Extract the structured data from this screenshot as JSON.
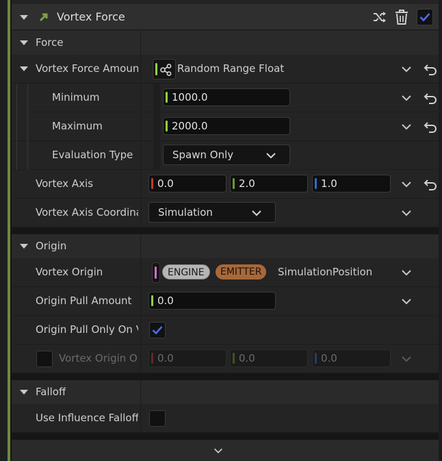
{
  "module": {
    "title": "Vortex Force",
    "icons": [
      "shuffle-icon",
      "trash-icon",
      "checkbox-checked-icon"
    ],
    "accent_color": "#6f8a3e"
  },
  "sections": {
    "force": {
      "title": "Force"
    },
    "origin": {
      "title": "Origin"
    },
    "falloff": {
      "title": "Falloff"
    }
  },
  "rows": {
    "vortex_force_amount": {
      "label": "Vortex Force Amoun",
      "value": "Random Range Float"
    },
    "minimum": {
      "label": "Minimum",
      "value": "1000.0"
    },
    "maximum": {
      "label": "Maximum",
      "value": "2000.0"
    },
    "evaluation_type": {
      "label": "Evaluation Type",
      "value": "Spawn Only"
    },
    "vortex_axis": {
      "label": "Vortex Axis",
      "x": "0.0",
      "y": "2.0",
      "z": "1.0"
    },
    "vortex_axis_coord": {
      "label": "Vortex Axis Coordina",
      "value": "Simulation"
    },
    "vortex_origin": {
      "label": "Vortex Origin",
      "tag1": "ENGINE",
      "tag2": "EMITTER",
      "value": "SimulationPosition"
    },
    "origin_pull_amount": {
      "label": "Origin Pull Amount",
      "value": "0.0"
    },
    "origin_pull_only": {
      "label": "Origin Pull Only On V",
      "checked": true
    },
    "vortex_origin_offset": {
      "label": "Vortex Origin Of",
      "x": "0.0",
      "y": "0.0",
      "z": "0.0"
    },
    "use_influence_falloff": {
      "label": "Use Influence Falloff",
      "checked": false
    }
  },
  "colors": {
    "float_pin": "#8ad446",
    "vector_x": "#c23a2a",
    "vector_y": "#6a9a2e",
    "vector_z": "#2e6ec8",
    "position_pin": "#d46ad4",
    "engine_tag": "#b5b5b5",
    "emitter_tag": "#a8683a",
    "check_blue": "#4c6cff"
  }
}
